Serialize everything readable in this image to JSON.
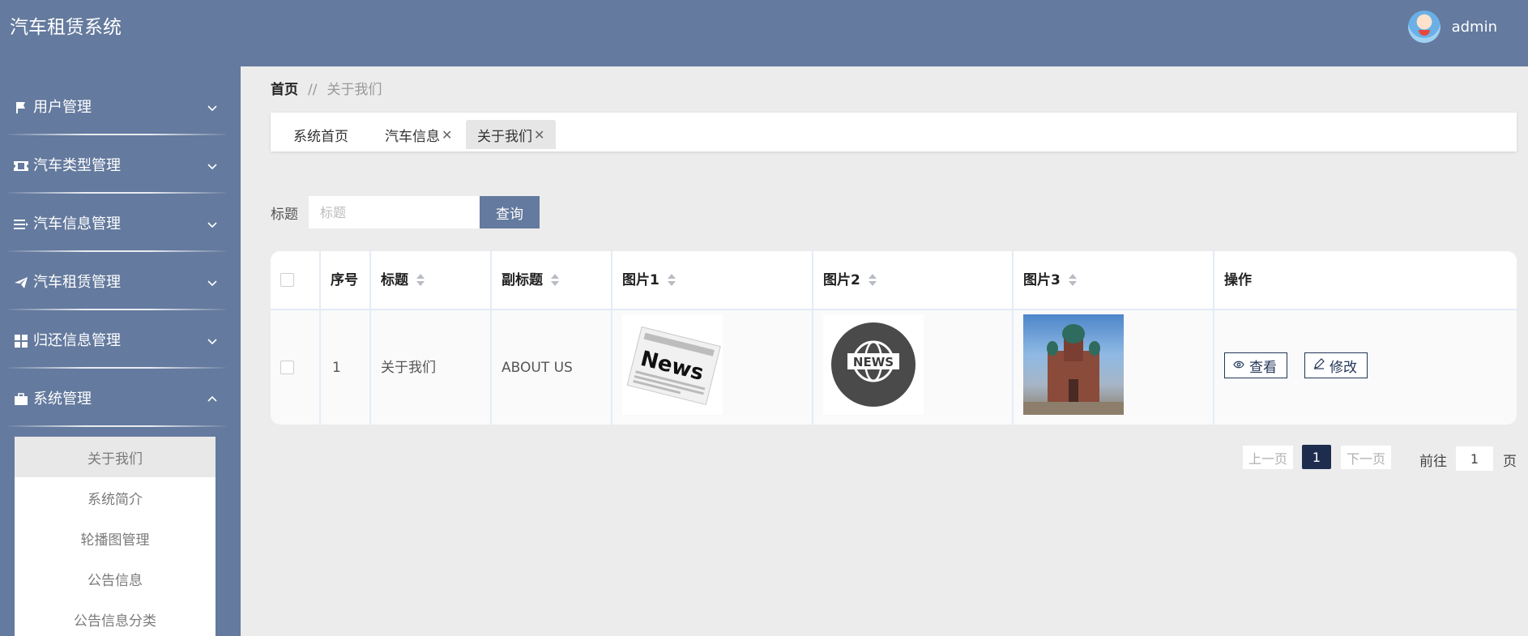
{
  "header": {
    "app_title": "汽车租赁系统",
    "username": "admin"
  },
  "sidebar": {
    "items": [
      {
        "label": "用户管理",
        "icon": "flag-icon",
        "expanded": false
      },
      {
        "label": "汽车类型管理",
        "icon": "ticket-icon",
        "expanded": false
      },
      {
        "label": "汽车信息管理",
        "icon": "list-icon",
        "expanded": false
      },
      {
        "label": "汽车租赁管理",
        "icon": "paper-plane-icon",
        "expanded": false
      },
      {
        "label": "归还信息管理",
        "icon": "grid-icon",
        "expanded": false
      },
      {
        "label": "系统管理",
        "icon": "briefcase-icon",
        "expanded": true
      }
    ],
    "submenu": [
      "关于我们",
      "系统简介",
      "轮播图管理",
      "公告信息",
      "公告信息分类"
    ]
  },
  "breadcrumb": {
    "home": "首页",
    "separator": "//",
    "current": "关于我们"
  },
  "tabs": [
    {
      "label": "系统首页",
      "closable": false,
      "active": false
    },
    {
      "label": "汽车信息",
      "closable": true,
      "active": false
    },
    {
      "label": "关于我们",
      "closable": true,
      "active": true
    }
  ],
  "search": {
    "label": "标题",
    "placeholder": "标题",
    "button": "查询"
  },
  "table": {
    "headers": {
      "index": "序号",
      "title": "标题",
      "subtitle": "副标题",
      "image1": "图片1",
      "image2": "图片2",
      "image3": "图片3",
      "actions": "操作"
    },
    "rows": [
      {
        "index": "1",
        "title": "关于我们",
        "subtitle": "ABOUT US",
        "image1": "News",
        "image2": "NEWS",
        "view": "查看",
        "edit": "修改"
      }
    ]
  },
  "pagination": {
    "prev": "上一页",
    "current": "1",
    "next": "下一页",
    "goto_label": "前往",
    "goto_value": "1",
    "page_unit": "页"
  },
  "colors": {
    "primary": "#647a9e",
    "pager_active": "#1e2c4e",
    "outline": "#23365a"
  }
}
